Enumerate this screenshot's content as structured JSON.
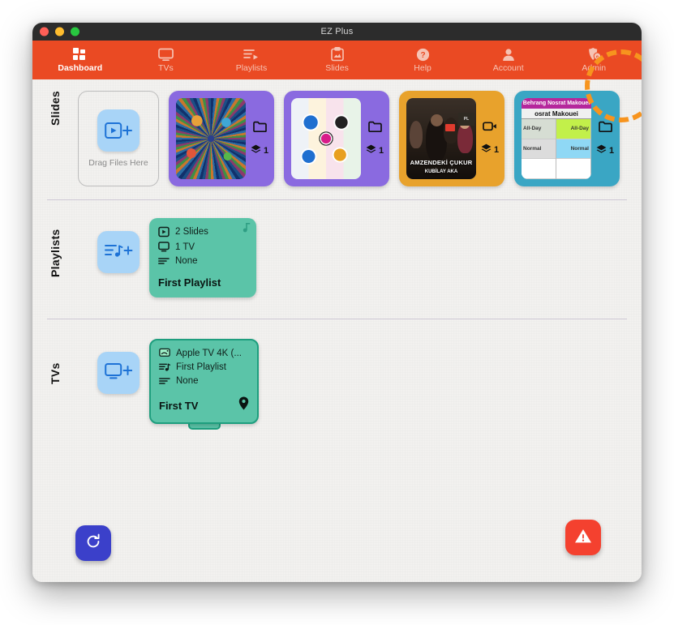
{
  "window": {
    "title": "EZ Plus",
    "traffic_lights": [
      "close-red",
      "minimize-yellow",
      "zoom-green"
    ]
  },
  "toolbar": {
    "items": [
      {
        "label": "Dashboard",
        "icon": "dashboard-grid-icon",
        "active": true
      },
      {
        "label": "TVs",
        "icon": "tv-icon",
        "active": false
      },
      {
        "label": "Playlists",
        "icon": "playlist-icon",
        "active": false
      },
      {
        "label": "Slides",
        "icon": "slides-clipboard-icon",
        "active": false
      },
      {
        "label": "Help",
        "icon": "help-question-icon",
        "active": false
      },
      {
        "label": "Account",
        "icon": "account-person-icon",
        "active": false
      },
      {
        "label": "Admin",
        "icon": "admin-shield-icon",
        "active": false,
        "highlighted": true
      }
    ],
    "bar_color": "#ea4a23",
    "highlight_color": "#f7941e"
  },
  "sections": {
    "slides": {
      "label": "Slides",
      "dropzone_label": "Drag Files Here",
      "dropzone_icon": "add-slide-icon",
      "cards": [
        {
          "art": "burst",
          "accent": "#8a6ae0",
          "type_icon": "folder-icon",
          "layers_icon": "layers-icon",
          "layers_count": "1"
        },
        {
          "art": "gears",
          "accent": "#8a6ae0",
          "type_icon": "folder-icon",
          "layers_icon": "layers-icon",
          "layers_count": "1"
        },
        {
          "art": "video",
          "accent": "#e8a22c",
          "type_icon": "video-camera-icon",
          "layers_icon": "layers-icon",
          "layers_count": "1",
          "caption": "AMZENDEKİ ÇUKUR",
          "subcaption": "KUBİLAY AKA"
        },
        {
          "art": "calendar",
          "accent": "#3aa6c4",
          "type_icon": "folder-icon",
          "layers_icon": "layers-icon",
          "layers_count": "1",
          "banner": "Behrang Nosrat Makouei",
          "header": "osrat Makouei",
          "cells_left": [
            "All-Day",
            "Normal",
            ""
          ],
          "cells_right": [
            "All-Day",
            "Normal",
            ""
          ]
        }
      ]
    },
    "playlists": {
      "label": "Playlists",
      "add_icon": "add-playlist-icon",
      "cards": [
        {
          "rows": [
            {
              "icon": "slide-play-icon",
              "text": "2 Slides"
            },
            {
              "icon": "tv-icon",
              "text": "1 TV"
            },
            {
              "icon": "list-lines-icon",
              "text": "None"
            }
          ],
          "title": "First Playlist",
          "corner_icon": "music-note-icon",
          "color": "#5bc4a8"
        }
      ]
    },
    "tvs": {
      "label": "TVs",
      "add_icon": "add-tv-icon",
      "cards": [
        {
          "rows": [
            {
              "icon": "airplay-icon",
              "text": "Apple TV 4K (..."
            },
            {
              "icon": "playlist-icon",
              "text": "First Playlist"
            },
            {
              "icon": "list-lines-icon",
              "text": "None"
            }
          ],
          "title": "First TV",
          "corner_icon": "location-pin-icon",
          "color": "#5bc4a8"
        }
      ]
    }
  },
  "floating_buttons": [
    {
      "name": "refresh-button",
      "icon": "refresh-icon",
      "color": "#3b40ca"
    },
    {
      "name": "alert-button",
      "icon": "warning-triangle-icon",
      "color": "#f4412f"
    }
  ]
}
